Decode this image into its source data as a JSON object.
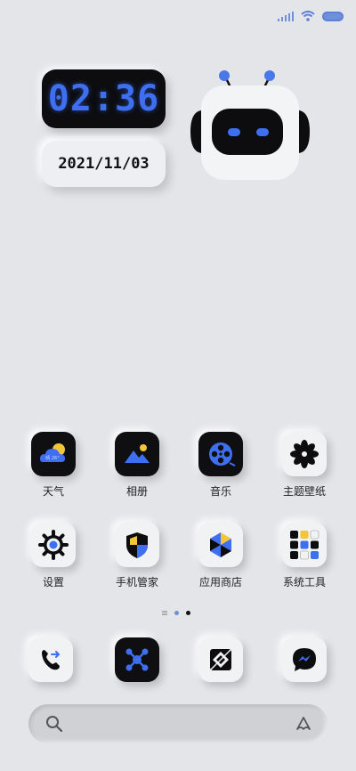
{
  "status_bar": {
    "signal": "signal-icon",
    "wifi": "wifi-icon",
    "battery": "battery-icon"
  },
  "clock": {
    "time": "02:36",
    "date": "2021/11/03"
  },
  "colors": {
    "accent": "#3e6ff0",
    "accent_light": "#6f8fd8",
    "background": "#e4e5e9",
    "yellow": "#f3c63a",
    "dark_tile": "#0f0f12"
  },
  "apps_row1": [
    {
      "label": "天气",
      "icon": "weather-icon"
    },
    {
      "label": "相册",
      "icon": "gallery-icon"
    },
    {
      "label": "音乐",
      "icon": "music-icon"
    },
    {
      "label": "主题壁纸",
      "icon": "themes-icon"
    }
  ],
  "apps_row2": [
    {
      "label": "设置",
      "icon": "settings-icon"
    },
    {
      "label": "手机管家",
      "icon": "security-icon"
    },
    {
      "label": "应用商店",
      "icon": "app-store-icon"
    },
    {
      "label": "系统工具",
      "icon": "tools-folder-icon"
    }
  ],
  "dock": [
    {
      "icon": "phone-icon"
    },
    {
      "icon": "network-app-icon"
    },
    {
      "icon": "camera-icon"
    },
    {
      "icon": "messenger-icon"
    }
  ],
  "page_indicator": {
    "pages": 2,
    "current": 2
  },
  "search": {
    "placeholder": "",
    "search_icon": "search-icon",
    "assistant_icon": "assistant-icon"
  }
}
